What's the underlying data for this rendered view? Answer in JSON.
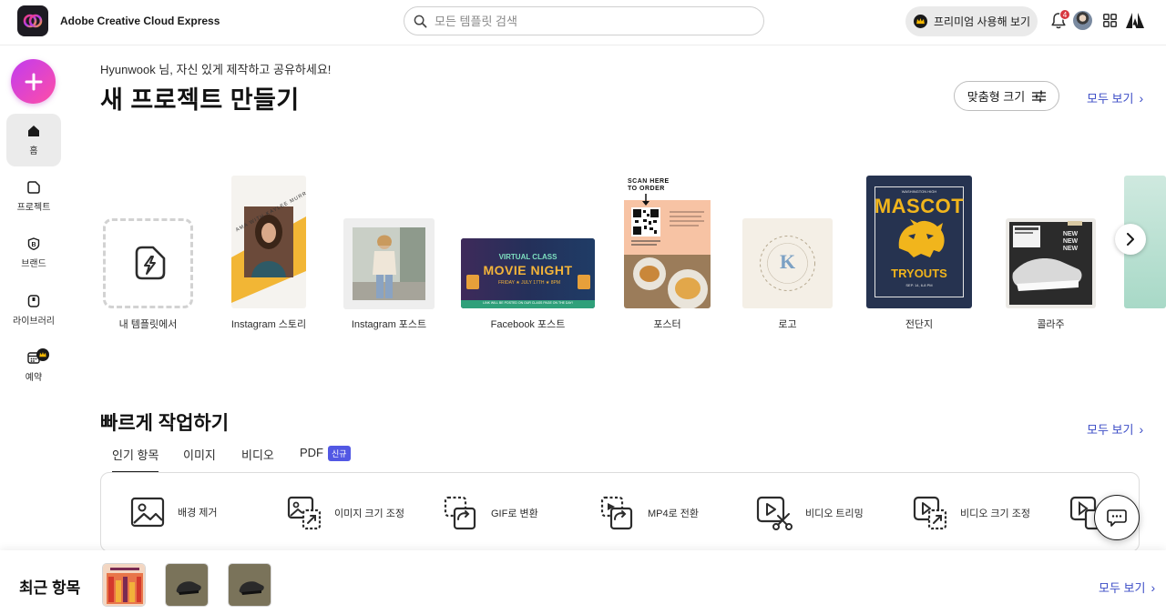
{
  "header": {
    "app_name": "Adobe Creative Cloud Express",
    "search_placeholder": "모든 템플릿 검색",
    "premium_button": "프리미엄 사용해 보기",
    "notification_count": "4"
  },
  "sidebar": {
    "items": [
      {
        "label": "홈",
        "icon": "home-icon",
        "active": true
      },
      {
        "label": "프로젝트",
        "icon": "project-icon",
        "active": false
      },
      {
        "label": "브랜드",
        "icon": "brand-icon",
        "active": false
      },
      {
        "label": "라이브러리",
        "icon": "library-icon",
        "active": false
      },
      {
        "label": "예약",
        "icon": "calendar-icon",
        "active": false
      }
    ]
  },
  "main": {
    "greeting": "Hyunwook 님, 자신 있게 제작하고 공유하세요!",
    "title": "새 프로젝트 만들기",
    "custom_size_button": "맞춤형 크기",
    "see_all": "모두 보기",
    "templates": [
      {
        "label": "내 템플릿에서"
      },
      {
        "label": "Instagram 스토리",
        "thumb_text": "AMA WITH KAYLEE MURRAY"
      },
      {
        "label": "Instagram 포스트"
      },
      {
        "label": "Facebook 포스트",
        "thumb_lines": [
          "VIRTUAL CLASS",
          "MOVIE NIGHT",
          "FRIDAY",
          "JULY 17TH",
          "8PM",
          "LINK WILL BE POSTED ON OUR CLASS PAGE ON THE DAY!"
        ]
      },
      {
        "label": "포스터",
        "thumb_lines": [
          "SCAN HERE",
          "TO ORDER"
        ]
      },
      {
        "label": "로고",
        "thumb_text": "K"
      },
      {
        "label": "전단지",
        "thumb_lines": [
          "WASHINGTON HIGH",
          "MASCOT",
          "TRYOUTS",
          "SEP. 14, 6-8 PM"
        ]
      },
      {
        "label": "콜라주",
        "thumb_lines": [
          "NEW",
          "NEW",
          "NEW"
        ]
      }
    ]
  },
  "quick_actions": {
    "title": "빠르게 작업하기",
    "see_all": "모두 보기",
    "tabs": [
      {
        "label": "인기 항목",
        "active": true
      },
      {
        "label": "이미지"
      },
      {
        "label": "비디오"
      },
      {
        "label": "PDF"
      }
    ],
    "new_badge": "신규",
    "items": [
      {
        "label": "배경 제거",
        "icon": "remove-background-icon"
      },
      {
        "label": "이미지 크기 조정",
        "icon": "resize-image-icon"
      },
      {
        "label": "GIF로 변환",
        "icon": "convert-gif-icon"
      },
      {
        "label": "MP4로 전환",
        "icon": "convert-mp4-icon"
      },
      {
        "label": "비디오 트리밍",
        "icon": "trim-video-icon"
      },
      {
        "label": "비디오 크기 조정",
        "icon": "resize-video-icon"
      }
    ]
  },
  "recent": {
    "title": "최근 항목",
    "see_all": "모두 보기"
  },
  "colors": {
    "accent_link": "#3b4cc6",
    "create_gradient_start": "#c13cf0",
    "create_gradient_end": "#ff4da6",
    "badge_new": "#5258e4",
    "notification_badge": "#d7373f"
  }
}
